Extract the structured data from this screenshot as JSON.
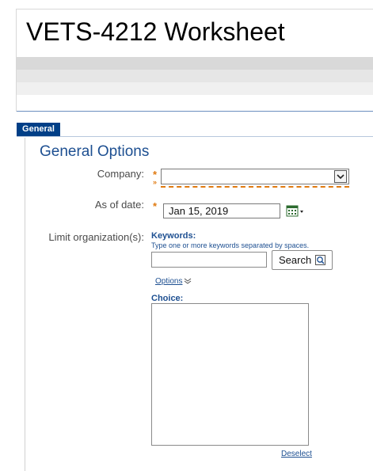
{
  "header": {
    "title": "VETS-4212 Worksheet"
  },
  "tabs": [
    {
      "label": "General"
    }
  ],
  "section": {
    "title": "General Options"
  },
  "form": {
    "company": {
      "label": "Company:",
      "value": ""
    },
    "as_of_date": {
      "label": "As of date:",
      "value": "Jan 15, 2019"
    },
    "limit_org": {
      "label": "Limit organization(s):",
      "keywords_label": "Keywords:",
      "keywords_hint": "Type one or more keywords separated by spaces.",
      "keywords_value": "",
      "search_button": "Search",
      "options_link": "Options",
      "choice_label": "Choice:",
      "choices": [],
      "deselect_link": "Deselect"
    }
  },
  "icons": {
    "required": "required-asterisk-icon",
    "calendar": "calendar-icon",
    "search": "magnifier-icon",
    "options": "chevron-down-icon"
  },
  "colors": {
    "accent": "#1d4f91",
    "tab_bg": "#003f87",
    "required": "#e07a10"
  }
}
